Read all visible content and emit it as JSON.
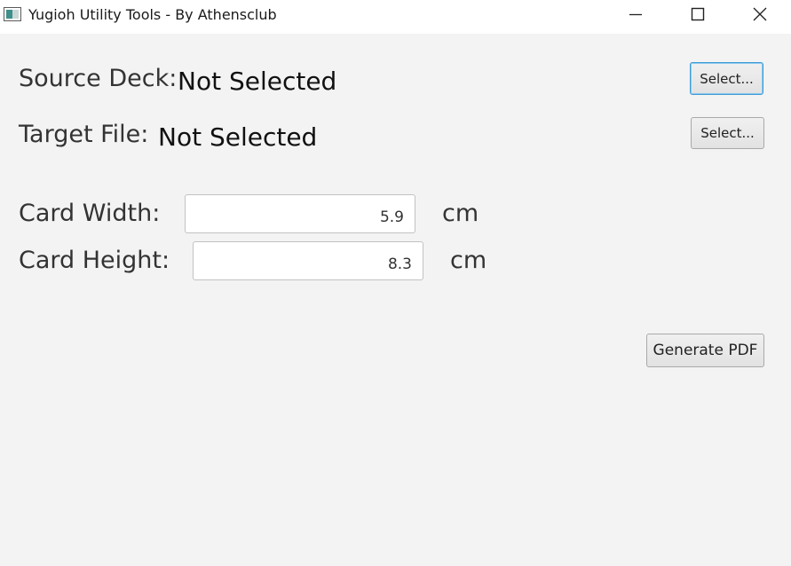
{
  "window": {
    "title": "Yugioh Utility Tools - By Athensclub"
  },
  "source_deck": {
    "label": "Source Deck:",
    "value": "Not Selected",
    "button_label": "Select..."
  },
  "target_file": {
    "label": "Target File:",
    "value": "Not Selected",
    "button_label": "Select..."
  },
  "card_width": {
    "label": "Card Width:",
    "value": "5.9",
    "unit": "cm"
  },
  "card_height": {
    "label": "Card Height:",
    "value": "8.3",
    "unit": "cm"
  },
  "actions": {
    "generate_label": "Generate PDF"
  },
  "colors": {
    "background": "#f3f3f3",
    "focus_border": "#3d9bd6"
  }
}
